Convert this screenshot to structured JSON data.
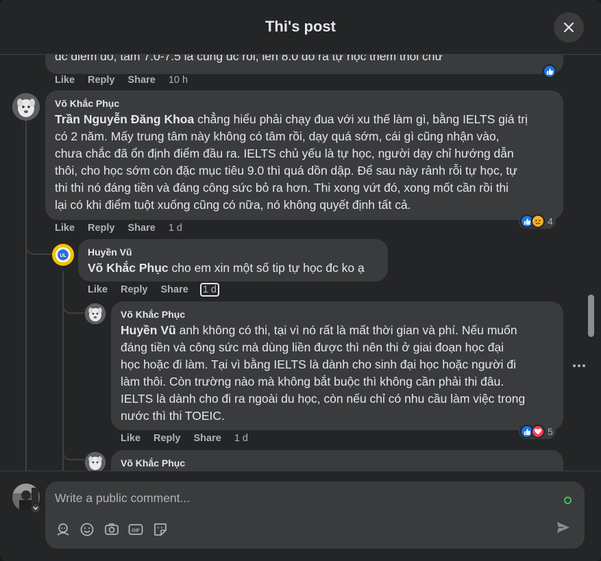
{
  "header": {
    "title": "Thi's post",
    "close_icon": "close-icon"
  },
  "comments": [
    {
      "text_fragment": "đc điểm đó, tầm 7.0-7.5 là cũng đc rồi, lên 8.0 đó ra tự học thêm thôi chứ",
      "actions": {
        "like": "Like",
        "reply": "Reply",
        "share": "Share",
        "time": "10 h"
      }
    },
    {
      "author": "Võ Khắc Phục",
      "mention": "Trần Nguyễn Đăng Khoa",
      "line1": " chẳng hiểu phải chạy đua với xu thế làm gì, bằng IELTS giá trị",
      "line2": "có 2 năm. Mấy trung tâm này không có tâm rồi, dạy quá sớm, cái gì cũng nhận vào,",
      "line3": "chưa chắc đã ổn định điểm đầu ra. IELTS chủ yếu là tự học, người dạy chỉ hướng dẫn",
      "line4": "thôi, cho học sớm còn đặc mục tiêu 9.0 thì quá dồn dập. Để sau này rảnh rỗi tự học, tự",
      "line5": "thi thì nó đáng tiền và đáng công sức bỏ ra hơn. Thi xong vứt đó, xong mốt cần rồi thi",
      "line6": "lại có khi điểm tuột xuống cũng có nữa, nó không quyết định tất cả.",
      "actions": {
        "like": "Like",
        "reply": "Reply",
        "share": "Share",
        "time": "1 d"
      },
      "reaction_count": "4"
    },
    {
      "author": "Huyền Vũ",
      "mention": "Võ Khắc Phục",
      "line1": " cho em xin một số tip tự học đc ko ạ",
      "actions": {
        "like": "Like",
        "reply": "Reply",
        "share": "Share",
        "time": "1 d"
      }
    },
    {
      "author": "Võ Khắc Phục",
      "mention": "Huyền Vũ",
      "line1": " anh không có thi, tại vì nó rất là mất thời gian và phí. Nếu muốn",
      "line2": "đáng tiền và công sức mà dùng liền được thì nên thi ở giai đoạn học đại",
      "line3": "học hoặc đi làm. Tại vì bằng IELTS là dành cho sinh đại học hoặc người đi",
      "line4": "làm thôi. Còn trường nào mà không bắt buộc thì không cần phải thi đâu.",
      "line5": "IELTS là dành cho đi ra ngoài du học, còn nếu chỉ có nhu cầu làm việc trong",
      "line6": "nước thì thi TOEIC.",
      "actions": {
        "like": "Like",
        "reply": "Reply",
        "share": "Share",
        "time": "1 d"
      },
      "reaction_count": "5"
    },
    {
      "author": "Võ Khắc Phục"
    }
  ],
  "composer": {
    "placeholder": "Write a public comment..."
  },
  "colors": {
    "background": "#242526",
    "bubble": "#3a3b3c",
    "text": "#e4e6eb",
    "muted": "#b0b3b8",
    "like_blue": "#1b74e4",
    "online_green": "#45bd62"
  }
}
